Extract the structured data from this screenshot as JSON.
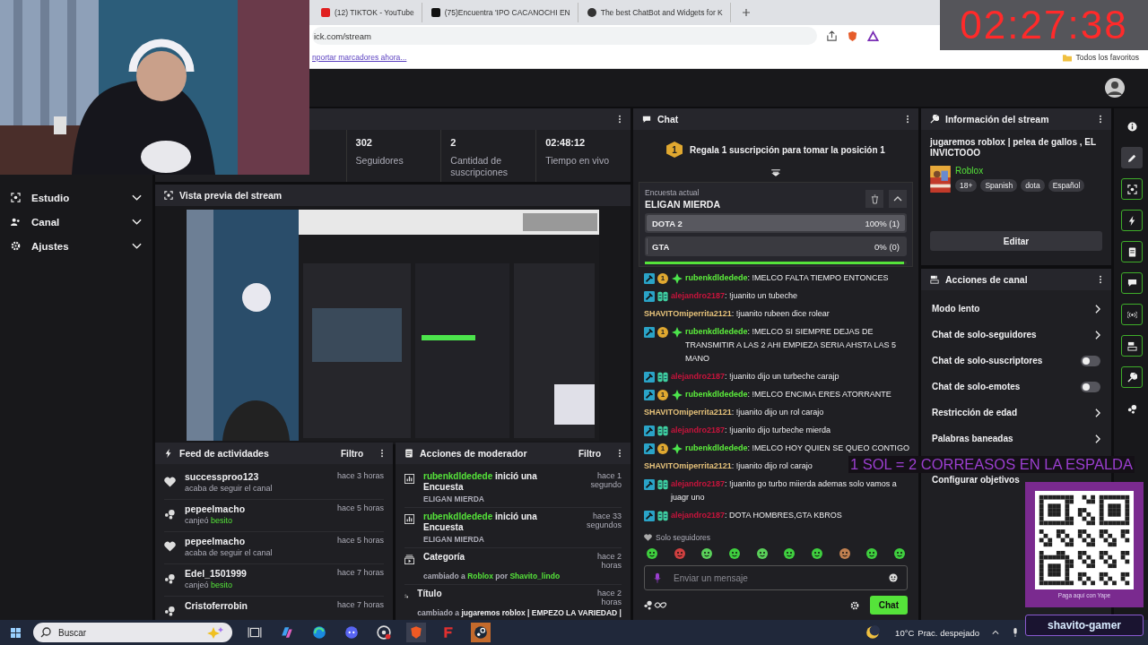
{
  "browser": {
    "tabs": [
      {
        "title": "(12) TIKTOK - YouTube",
        "kind": "video"
      },
      {
        "title": "(75)Encuentra 'IPO CACANOCHI EN",
        "kind": "tiktok"
      },
      {
        "title": "The best ChatBot and Widgets for K",
        "kind": "bot"
      }
    ],
    "address": "ick.com/stream",
    "bookmark_link": "nportar marcadores ahora...",
    "all_bookmarks": "Todos los favoritos"
  },
  "clock": "02:27:38",
  "sidebar": {
    "items": [
      {
        "label": "Estudio",
        "kind": "studio",
        "expanded": false
      },
      {
        "label": "Canal",
        "kind": "channel",
        "expanded": false
      },
      {
        "label": "Ajustes",
        "kind": "settings",
        "expanded": false
      }
    ]
  },
  "stats": [
    {
      "value": "302",
      "label": "Seguidores"
    },
    {
      "value": "2",
      "label": "Cantidad de suscripciones"
    },
    {
      "value": "02:48:12",
      "label": "Tiempo en vivo"
    }
  ],
  "preview": {
    "title": "Vista previa del stream"
  },
  "activity_feed": {
    "title": "Feed de actividades",
    "filter": "Filtro",
    "items": [
      {
        "kind": "follow",
        "user": "successproo123",
        "time": "hace 3 horas",
        "action": "acaba de seguir el canal"
      },
      {
        "kind": "redeem",
        "user": "pepeelmacho",
        "time": "hace 5 horas",
        "action": "canjeó",
        "reward": "besito"
      },
      {
        "kind": "follow",
        "user": "pepeelmacho",
        "time": "hace 5 horas",
        "action": "acaba de seguir el canal"
      },
      {
        "kind": "redeem",
        "user": "Edel_1501999",
        "time": "hace 7 horas",
        "action": "canjeó",
        "reward": "besito"
      },
      {
        "kind": "redeem",
        "user": "Cristoferrobin",
        "time": "hace 7 horas"
      }
    ]
  },
  "mod_actions": {
    "title": "Acciones de moderador",
    "filter": "Filtro",
    "items": [
      {
        "kind": "poll",
        "title": [
          {
            "text": "rubenkdldedede",
            "kind": "user"
          },
          {
            "text": " inició una Encuesta",
            "kind": "plain"
          }
        ],
        "detail": [
          {
            "text": "ELIGAN MIERDA",
            "kind": "plain"
          }
        ],
        "time": "hace 1 segundo"
      },
      {
        "kind": "poll",
        "title": [
          {
            "text": "rubenkdldedede",
            "kind": "user"
          },
          {
            "text": " inició una Encuesta",
            "kind": "plain"
          }
        ],
        "detail": [
          {
            "text": "ELIGAN MIERDA",
            "kind": "plain"
          }
        ],
        "time": "hace 33 segundos"
      },
      {
        "kind": "category",
        "title": [
          {
            "text": "Categoría",
            "kind": "plain"
          }
        ],
        "detail": [
          {
            "text": "cambiado a ",
            "kind": "plain"
          },
          {
            "text": "Roblox",
            "kind": "highlight"
          },
          {
            "text": " por ",
            "kind": "plain"
          },
          {
            "text": "Shavito_lindo",
            "kind": "highlight"
          }
        ],
        "time": "hace 2 horas"
      },
      {
        "kind": "title",
        "title": [
          {
            "text": "Título",
            "kind": "plain"
          }
        ],
        "detail": [
          {
            "text": "cambiado a ",
            "kind": "plain"
          },
          {
            "text": "jugaremos roblox | EMPEZO LA VARIEDAD |",
            "kind": "strong"
          }
        ],
        "time": "hace 2 horas"
      }
    ]
  },
  "chat": {
    "title": "Chat",
    "hype": {
      "badge": "1",
      "text": "Regala 1 suscripción para tomar la posición 1"
    },
    "poll": {
      "caption": "Encuesta actual",
      "question": "ELIGAN MIERDA",
      "options": [
        {
          "label": "DOTA 2",
          "reading": "100% (1)",
          "level": 1
        },
        {
          "label": "GTA",
          "reading": "0% (0)",
          "level": 0
        }
      ],
      "timer": {
        "level": 0.99
      }
    },
    "messages": [
      {
        "user": "rubenkdldedede",
        "color": "#5cee3c",
        "badges": [
          {
            "kind": "mod"
          },
          {
            "kind": "sub",
            "label": "1"
          },
          {
            "kind": "sparkle"
          }
        ],
        "text": ": !MELCO FALTA TIEMPO ENTONCES"
      },
      {
        "user": "alejandro2187",
        "color": "#c8143c",
        "badges": [
          {
            "kind": "mod"
          },
          {
            "kind": "vip"
          }
        ],
        "text": ": !juanito un tubeche"
      },
      {
        "user": "SHAVITOmiperrita2121",
        "color": "#e6c27a",
        "text": ": !juanito rubeen dice rolear"
      },
      {
        "user": "rubenkdldedede",
        "color": "#5cee3c",
        "badges": [
          {
            "kind": "mod"
          },
          {
            "kind": "sub",
            "label": "1"
          },
          {
            "kind": "sparkle"
          }
        ],
        "text": ": !MELCO SI SIEMPRE DEJAS DE TRANSMITIR A LAS 2 AHI EMPIEZA SERIA AHSTA LAS 5 MANO"
      },
      {
        "user": "alejandro2187",
        "color": "#c8143c",
        "badges": [
          {
            "kind": "mod"
          },
          {
            "kind": "vip"
          }
        ],
        "text": ": !juanito dijo un turbeche carajp"
      },
      {
        "user": "rubenkdldedede",
        "color": "#5cee3c",
        "badges": [
          {
            "kind": "mod"
          },
          {
            "kind": "sub",
            "label": "1"
          },
          {
            "kind": "sparkle"
          }
        ],
        "text": ": !MELCO ENCIMA ERES ATORRANTE"
      },
      {
        "user": "SHAVITOmiperrita2121",
        "color": "#e6c27a",
        "text": ": !juanito dijo un rol carajo"
      },
      {
        "user": "alejandro2187",
        "color": "#c8143c",
        "badges": [
          {
            "kind": "mod"
          },
          {
            "kind": "vip"
          }
        ],
        "text": ": !juanito dijo turbeche mierda"
      },
      {
        "user": "rubenkdldedede",
        "color": "#5cee3c",
        "badges": [
          {
            "kind": "mod"
          },
          {
            "kind": "sub",
            "label": "1"
          },
          {
            "kind": "sparkle"
          }
        ],
        "text": ": !MELCO HOY QUIEN SE QUEO CONTIGO"
      },
      {
        "user": "SHAVITOmiperrita2121",
        "color": "#e6c27a",
        "text": ": !juanito dijo rol carajo"
      },
      {
        "user": "alejandro2187",
        "color": "#c8143c",
        "badges": [
          {
            "kind": "mod"
          },
          {
            "kind": "vip"
          }
        ],
        "text": ": !juanito go turbo miierda ademas solo vamos a juagr uno"
      },
      {
        "user": "alejandro2187",
        "color": "#c8143c",
        "badges": [
          {
            "kind": "mod"
          },
          {
            "kind": "vip"
          }
        ],
        "text": ": DOTA HOMBRES,GTA KBROS"
      }
    ],
    "mode": "Solo seguidores",
    "placeholder": "Enviar un mensaje",
    "send": "Chat"
  },
  "stream_info": {
    "title": "Información del stream",
    "stream_title": "jugaremos roblox | pelea de gallos , EL INVICTOOO",
    "category": "Roblox",
    "tags": [
      "18+",
      "Spanish",
      "dota",
      "Español"
    ],
    "edit": "Editar"
  },
  "channel_actions": {
    "title": "Acciones de canal",
    "items": [
      {
        "label": "Modo lento",
        "kind": "link"
      },
      {
        "label": "Chat de solo-seguidores",
        "kind": "link"
      },
      {
        "label": "Chat de solo-suscriptores",
        "kind": "toggle",
        "on": false
      },
      {
        "label": "Chat de solo-emotes",
        "kind": "toggle",
        "on": false
      },
      {
        "label": "Restricción de edad",
        "kind": "link"
      },
      {
        "label": "Palabras baneadas",
        "kind": "link"
      },
      {
        "label": "Configurar objetivos",
        "kind": "plain"
      }
    ]
  },
  "rail": [
    {
      "kind": "info",
      "selected": false,
      "pinned": false
    },
    {
      "kind": "edit",
      "selected": true,
      "pinned": false
    },
    {
      "kind": "focus",
      "selected": false,
      "pinned": true
    },
    {
      "kind": "bolt",
      "selected": false,
      "pinned": true
    },
    {
      "kind": "note",
      "selected": false,
      "pinned": true
    },
    {
      "kind": "chat",
      "selected": false,
      "pinned": true
    },
    {
      "kind": "broadcast",
      "selected": false,
      "pinned": true
    },
    {
      "kind": "actions",
      "selected": false,
      "pinned": true
    },
    {
      "kind": "wrench",
      "selected": false,
      "pinned": true
    },
    {
      "kind": "dots",
      "selected": false,
      "pinned": false
    }
  ],
  "overlay": {
    "banner": "1 SOL = 2 CORREASOS EN LA ESPALDA",
    "qr_caption": "Paga aquí con Yape",
    "channel": "shavito-gamer"
  },
  "taskbar": {
    "search": "Buscar",
    "temperature": "10°C",
    "forecast": "Prac. despejado"
  }
}
